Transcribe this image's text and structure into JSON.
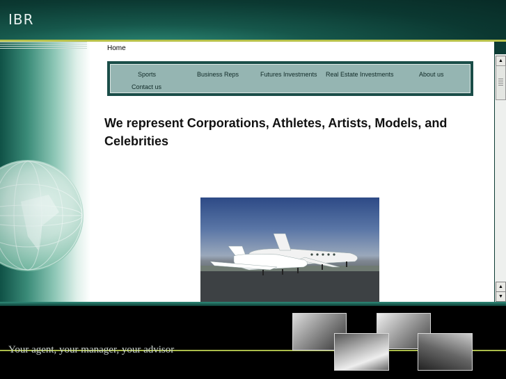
{
  "site": {
    "logo": "IBR"
  },
  "breadcrumb": "Home",
  "nav": {
    "items": [
      {
        "label": "Sports"
      },
      {
        "label": "Business Reps"
      },
      {
        "label": "Futures Investments"
      },
      {
        "label": "Real Estate Investments"
      },
      {
        "label": "About us"
      },
      {
        "label": "Contact us"
      }
    ]
  },
  "main": {
    "headline": "We represent Corporations, Athletes, Artists, Models, and Celebrities"
  },
  "footer": {
    "tagline": "Your agent, your manager, your advisor"
  },
  "colors": {
    "header": "#0b3831",
    "accent_line": "#b8c24a",
    "nav_bg": "#95b5b2",
    "nav_border": "#1a4d48"
  }
}
